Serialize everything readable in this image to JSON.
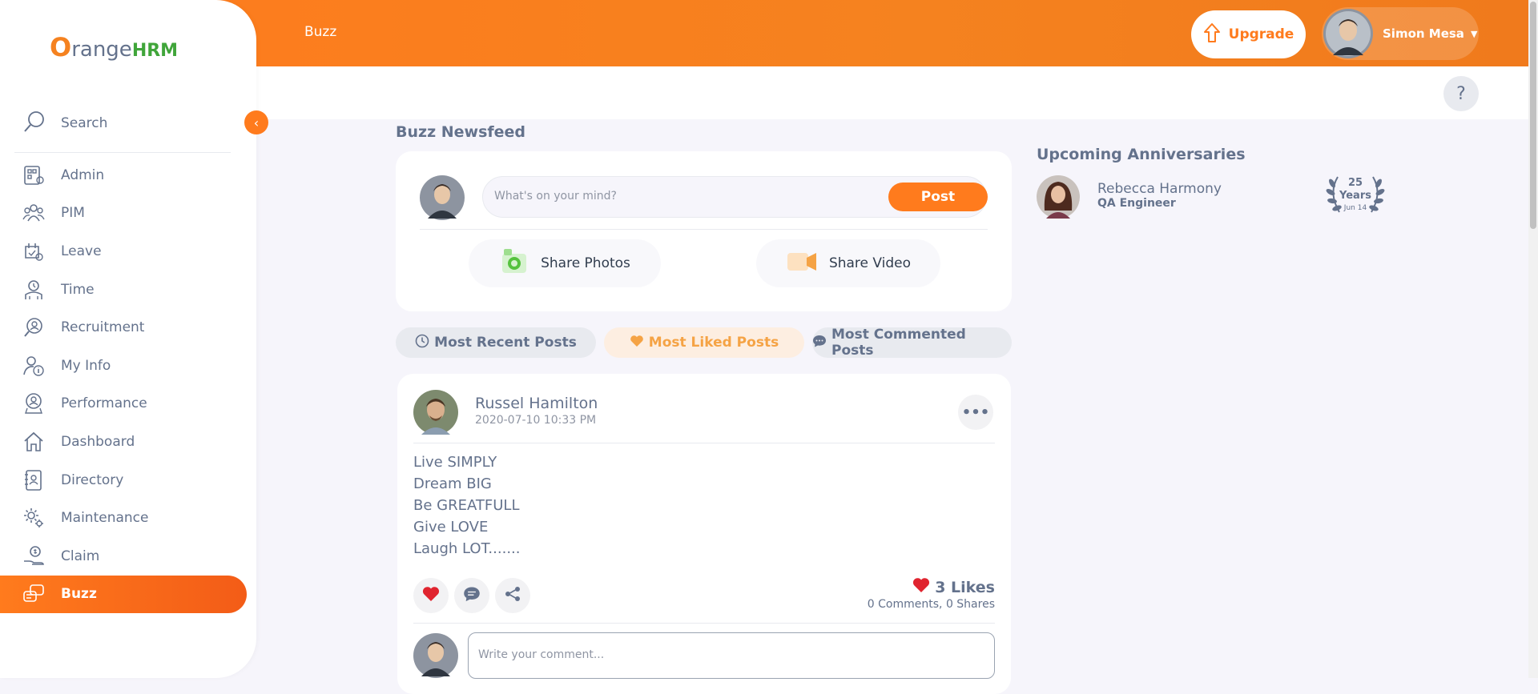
{
  "topbar": {
    "module": "Buzz",
    "upgrade_label": "Upgrade",
    "user_name": "Simon Mesa",
    "help_label": "?"
  },
  "sidebar": {
    "logo_o": "O",
    "logo_range": "range",
    "logo_hrm": "HRM",
    "search_label": "Search",
    "items": [
      {
        "label": "Admin"
      },
      {
        "label": "PIM"
      },
      {
        "label": "Leave"
      },
      {
        "label": "Time"
      },
      {
        "label": "Recruitment"
      },
      {
        "label": "My Info"
      },
      {
        "label": "Performance"
      },
      {
        "label": "Dashboard"
      },
      {
        "label": "Directory"
      },
      {
        "label": "Maintenance"
      },
      {
        "label": "Claim"
      },
      {
        "label": "Buzz"
      }
    ],
    "active": "Buzz"
  },
  "feed": {
    "title": "Buzz Newsfeed",
    "compose_placeholder": "What's on your mind?",
    "post_label": "Post",
    "share_photos": "Share Photos",
    "share_video": "Share Video",
    "filters": {
      "recent": "Most Recent Posts",
      "liked": "Most Liked Posts",
      "commented": "Most Commented Posts"
    },
    "post": {
      "author": "Russel Hamilton",
      "date": "2020-07-10 10:33 PM",
      "lines": [
        "Live SIMPLY",
        "Dream BIG",
        "Be GREATFULL",
        "Give LOVE",
        "Laugh LOT......."
      ],
      "likes": "3 Likes",
      "stats": "0 Comments, 0 Shares",
      "comment_placeholder": "Write your comment..."
    }
  },
  "anniversaries": {
    "title": "Upcoming Anniversaries",
    "name": "Rebecca Harmony",
    "role": "QA Engineer",
    "years_number": "25",
    "years_label": "Years",
    "date": "Jun 14"
  },
  "colors": {
    "brand": "#ff7b1d",
    "text": "#64728c",
    "heart": "#e0242f"
  }
}
